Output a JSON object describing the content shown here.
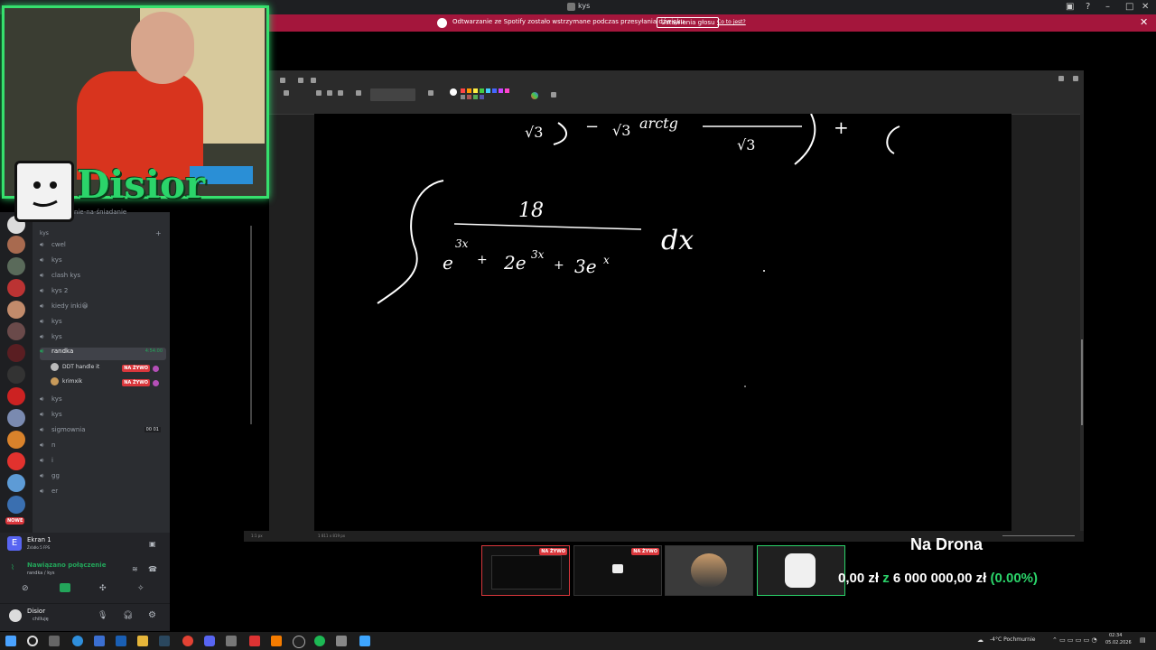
{
  "window": {
    "title": "kys"
  },
  "spotify_banner": {
    "message": "Odtwarzanie ze Spotify zostało wstrzymane podczas przesyłania dźwięku.",
    "button": "Ustawienia głosu",
    "link": "Co to jest?"
  },
  "paint": {
    "status_left": "1:1 px",
    "status_size": "1 811 x 819 px"
  },
  "canvas_math": {
    "numerator": "18",
    "denominator_base1": "e",
    "denominator_exp1": "3x",
    "plus1": "+",
    "denominator_term2": "2e",
    "denominator_exp2": "3x",
    "plus2": "+",
    "denominator_term3": "3e",
    "denominator_exp3": "x",
    "differential": "dx",
    "top_fragment_sqrt3a": "√3",
    "top_fragment_minus": "−",
    "top_fragment_sqrt3b": "√3",
    "top_fragment_arctg": "arctg",
    "top_fragment_sqrt3c": "√3",
    "top_fragment_plus": "+"
  },
  "streamer": {
    "name": "Disior"
  },
  "discord": {
    "category": "kys",
    "channels": [
      {
        "name": "wanie-na-śniadanie",
        "kind": "text"
      },
      {
        "name": "cwel",
        "kind": "voice"
      },
      {
        "name": "kys",
        "kind": "voice"
      },
      {
        "name": "clash kys",
        "kind": "voice"
      },
      {
        "name": "kys 2",
        "kind": "voice"
      },
      {
        "name": "kiedy inki😀",
        "kind": "voice"
      },
      {
        "name": "kys",
        "kind": "voice"
      },
      {
        "name": "kys",
        "kind": "voice"
      },
      {
        "name": "randka",
        "kind": "voice",
        "time": "4:54:00"
      },
      {
        "name": "kys",
        "kind": "voice"
      },
      {
        "name": "kys",
        "kind": "voice"
      },
      {
        "name": "sigmownia",
        "kind": "voice",
        "counts": "00 01"
      },
      {
        "name": "n",
        "kind": "voice"
      },
      {
        "name": "i",
        "kind": "voice"
      },
      {
        "name": "gg",
        "kind": "voice"
      },
      {
        "name": "er",
        "kind": "voice"
      }
    ],
    "voice_users": [
      {
        "name": "DDT handle it",
        "live": "NA ŻYWO"
      },
      {
        "name": "krimxik",
        "live": "NA ŻYWO"
      }
    ],
    "new_badge": "NOWE",
    "screen_share": {
      "title": "Ekran 1",
      "subtitle": "Źródło 5 FPS"
    },
    "connection": {
      "status": "Nawiązano połączenie",
      "location": "randka / kys"
    },
    "user": {
      "name": "Disior",
      "status": "chilluję"
    }
  },
  "thumbnails": [
    {
      "live": "NA ŻYWO"
    },
    {
      "live": "NA ŻYWO"
    },
    {
      "live": ""
    },
    {
      "live": ""
    }
  ],
  "donation": {
    "title": "Na Drona",
    "current": "0,00 zł",
    "sep": "z",
    "goal": "6 000 000,00 zł",
    "percent": "(0.00%)",
    "accent": "#2bd46a"
  },
  "taskbar": {
    "weather": "-4°C Pochmurnie",
    "time": "02:34",
    "date": "05.02.2026"
  }
}
